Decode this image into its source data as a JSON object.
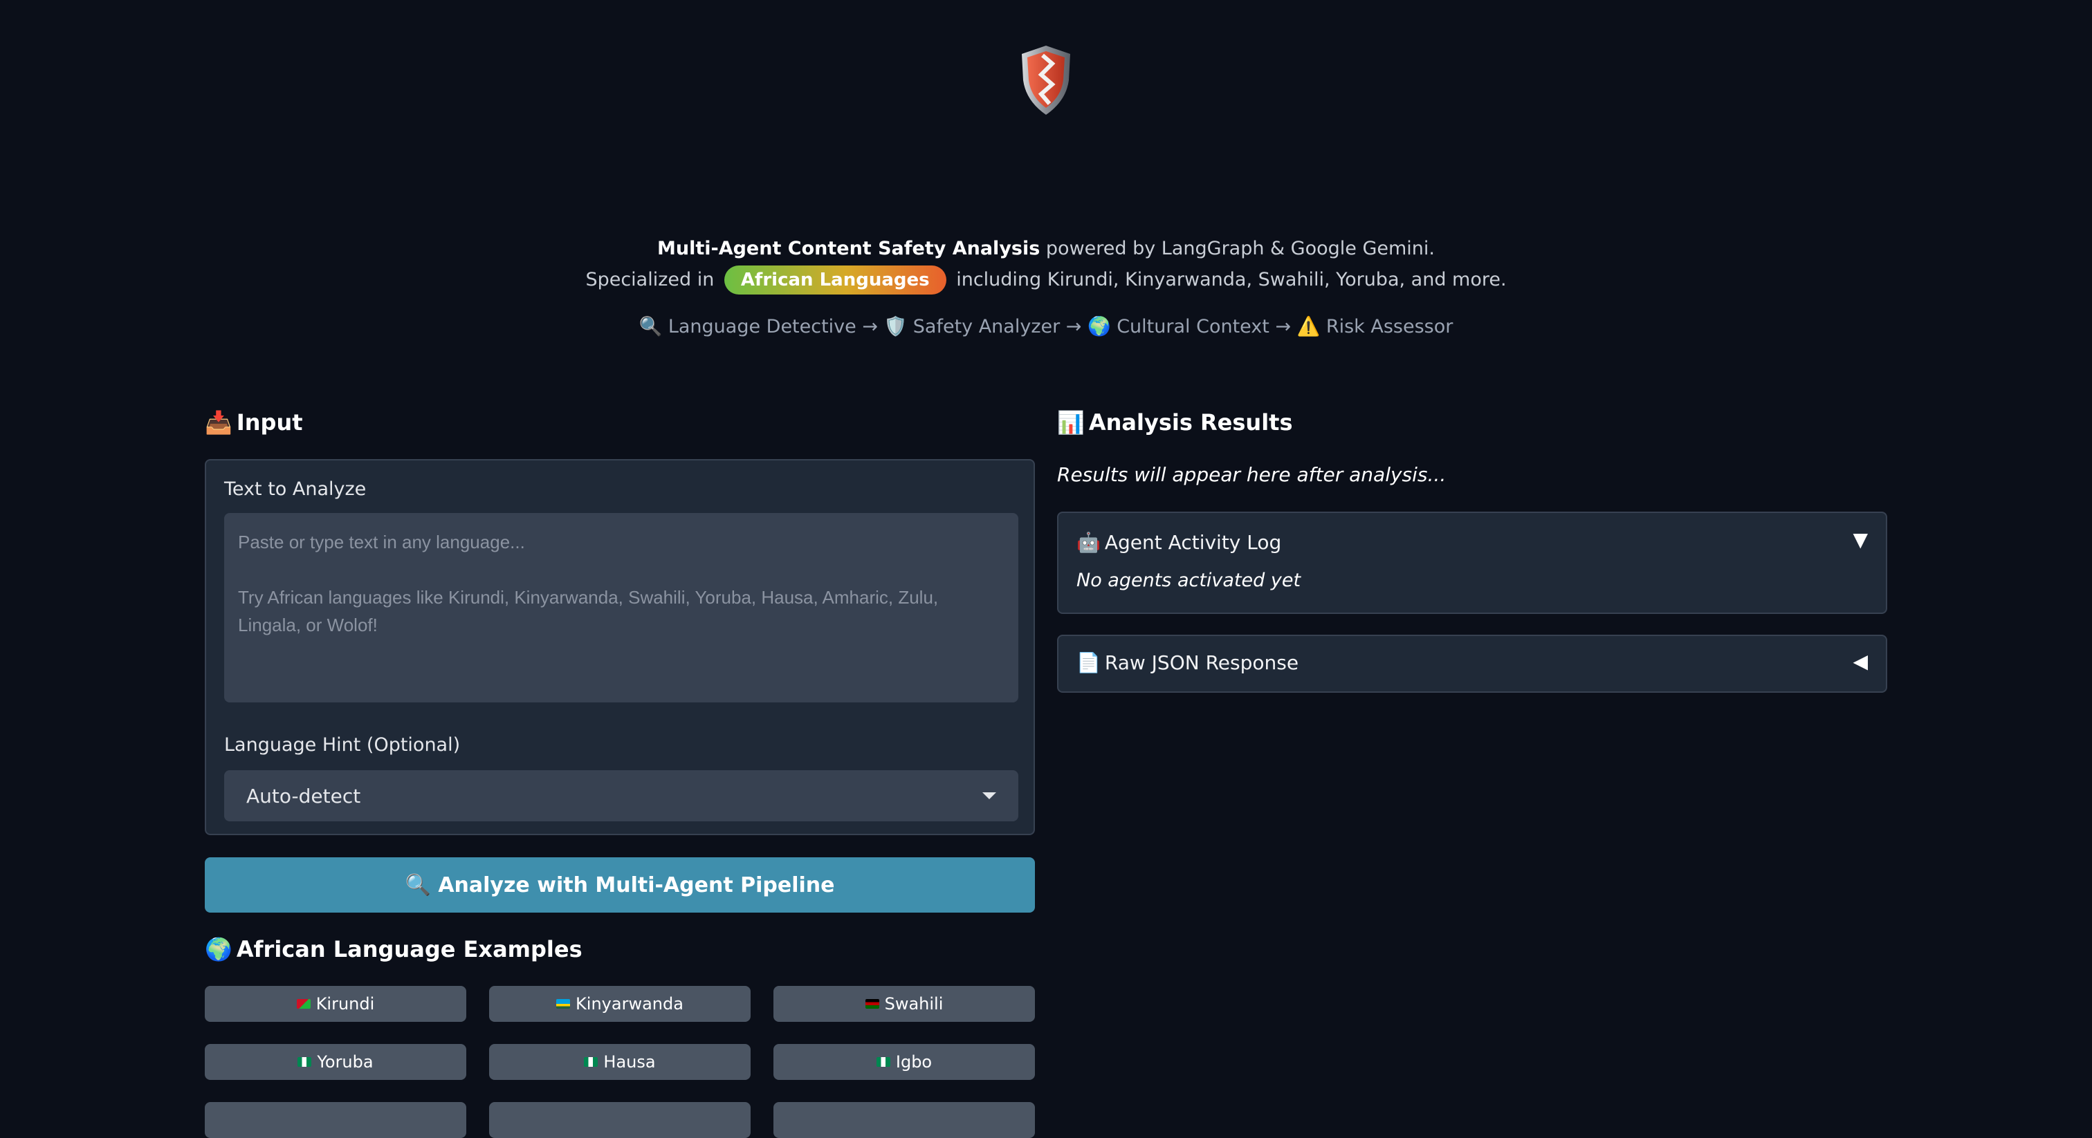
{
  "header": {
    "logo_icon": "shield-icon",
    "line1_bold": "Multi-Agent Content Safety Analysis",
    "line1_rest": " powered by LangGraph & Google Gemini.",
    "line2_prefix": "Specialized in ",
    "line2_pill": "African Languages",
    "line2_suffix": " including Kirundi, Kinyarwanda, Swahili, Yoruba, and more.",
    "pipeline": "🔍 Language Detective → 🛡️ Safety Analyzer → 🌍 Cultural Context → ⚠️ Risk Assessor"
  },
  "input": {
    "title": "Input",
    "title_emoji": "📥",
    "text_label": "Text to Analyze",
    "text_placeholder": "Paste or type text in any language...\n\nTry African languages like Kirundi, Kinyarwanda, Swahili, Yoruba, Hausa, Amharic, Zulu, Lingala, or Wolof!",
    "text_value": "",
    "hint_label": "Language Hint (Optional)",
    "hint_selected": "Auto-detect",
    "analyze_label": "🔍 Analyze with Multi-Agent Pipeline"
  },
  "examples": {
    "title": "African Language Examples",
    "title_emoji": "🌍",
    "items": [
      {
        "label": "Kirundi",
        "flag_colors": [
          "#ce1126",
          "#1eb53a"
        ]
      },
      {
        "label": "Kinyarwanda",
        "flag_colors": [
          "#00a1de",
          "#fad201"
        ]
      },
      {
        "label": "Swahili",
        "flag_colors": [
          "#000000",
          "#bb0000"
        ]
      },
      {
        "label": "Yoruba",
        "flag_colors": [
          "#008751",
          "#ffffff"
        ]
      },
      {
        "label": "Hausa",
        "flag_colors": [
          "#008751",
          "#ffffff"
        ]
      },
      {
        "label": "Igbo",
        "flag_colors": [
          "#008751",
          "#ffffff"
        ]
      }
    ]
  },
  "results": {
    "title": "Analysis Results",
    "title_emoji": "📊",
    "note": "Results will appear here after analysis...",
    "activity_log": {
      "emoji": "🤖",
      "title": "Agent Activity Log",
      "arrow": "▼",
      "body": "No agents activated yet"
    },
    "raw_json": {
      "emoji": "📄",
      "title": "Raw JSON Response",
      "arrow": "◀"
    }
  },
  "colors": {
    "background": "#0b0f19",
    "card": "#1f2937",
    "button_primary": "#3f8fad",
    "button_secondary": "#4b5563"
  }
}
